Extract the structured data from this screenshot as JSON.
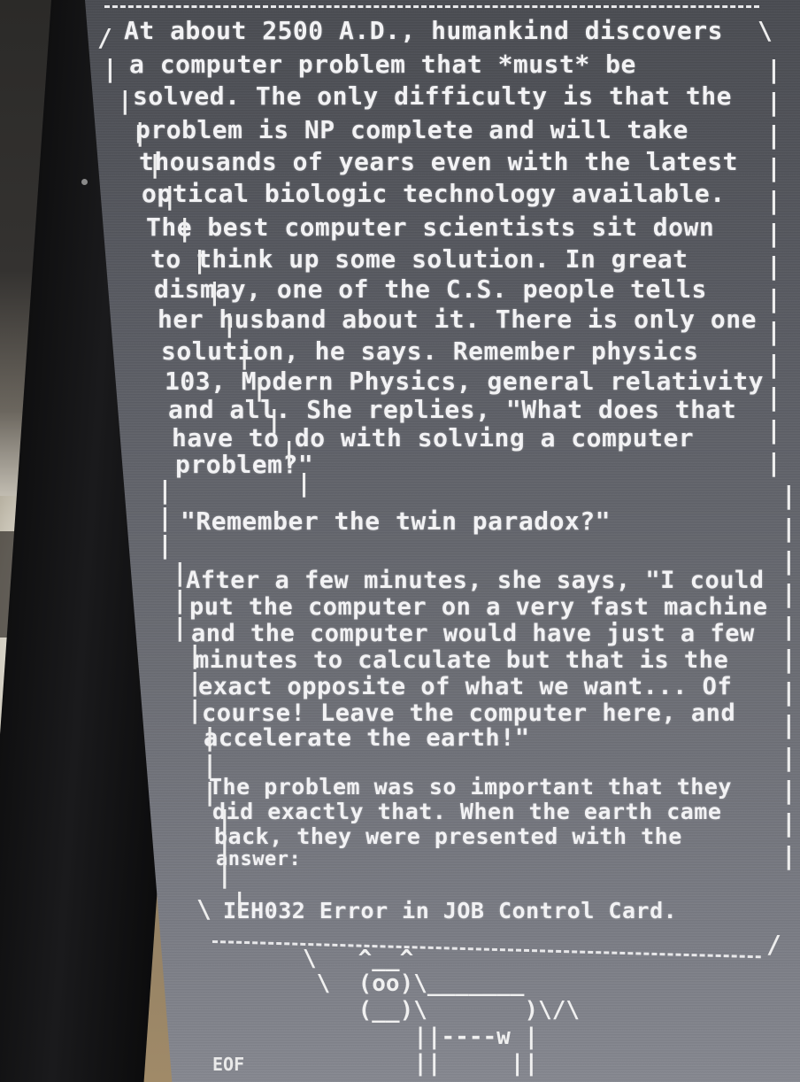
{
  "terminal": {
    "speech_lines": [
      "At about 2500 A.D., humankind discovers",
      "a computer problem that *must* be",
      "solved. The only difficulty is that the",
      "problem is NP complete and will take",
      "thousands of years even with the latest",
      "optical biologic technology available.",
      "The best computer scientists sit down",
      "to think up some solution. In great",
      "dismay, one of the C.S. people tells",
      "her husband about it. There is only one",
      "solution, he says. Remember physics",
      "103, Modern Physics, general relativity",
      "and all. She replies, \"What does that",
      "have to do with solving a computer",
      "problem?\"",
      "",
      "\"Remember the twin paradox?\"",
      "",
      "After a few minutes, she says, \"I could",
      "put the computer on a very fast machine",
      "and the computer would have just a few",
      "minutes to calculate but that is the",
      "exact opposite of what we want... Of",
      "course! Leave the computer here, and",
      "accelerate the earth!\"",
      "",
      "The problem was so important that they",
      "did exactly that. When the earth came",
      "back, they were presented with the",
      "answer:",
      "",
      "IEH032 Error in JOB Control Card."
    ],
    "cow_lines": [
      "\\   ^__^",
      " \\  (oo)\\_______",
      "    (__)\\       )\\/\\",
      "        ||----w |",
      "        ||     ||"
    ],
    "eof_label": "EOF",
    "colors": {
      "text": "#f2f2f4",
      "screen": "#5a5c63",
      "bezel": "#121214"
    }
  }
}
